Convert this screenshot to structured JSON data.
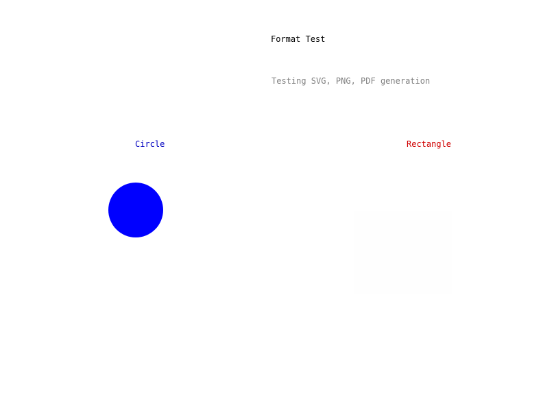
{
  "title": "Format Test",
  "subtitle": "Testing SVG, PNG, PDF generation",
  "shapes": {
    "circle": {
      "label": "Circle",
      "color": "#0000ff",
      "label_color": "#0000c0"
    },
    "rectangle": {
      "label": "Rectangle",
      "color": "#fefefe",
      "label_color": "#d00000"
    }
  }
}
